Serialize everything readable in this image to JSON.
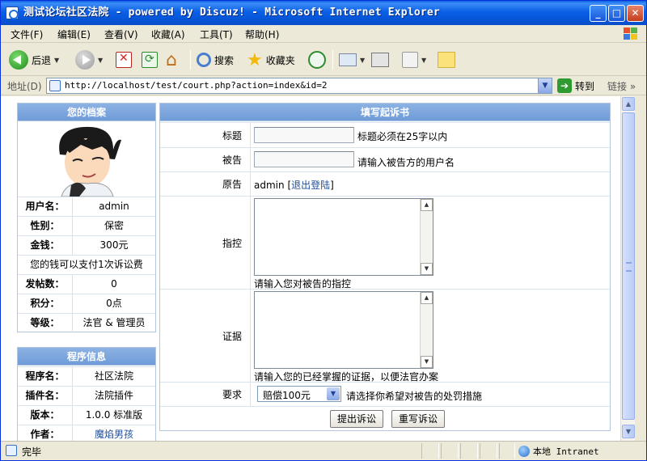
{
  "window": {
    "title": "测试论坛社区法院 - powered by Discuz! - Microsoft Internet Explorer",
    "controls": {
      "minimize": "_",
      "maximize": "□",
      "close": "✕"
    }
  },
  "menu": [
    "文件(F)",
    "编辑(E)",
    "查看(V)",
    "收藏(A)",
    "工具(T)",
    "帮助(H)"
  ],
  "toolbar": {
    "back": "后退",
    "search": "搜索",
    "favorites": "收藏夹"
  },
  "address": {
    "label": "地址(D)",
    "url": "http://localhost/test/court.php?action=index&id=2",
    "go": "转到",
    "links": "链接"
  },
  "profile": {
    "title": "您的档案",
    "rows": [
      {
        "key": "用户名：",
        "value": "admin"
      },
      {
        "key": "性别：",
        "value": "保密"
      },
      {
        "key": "金钱：",
        "value": "300元"
      }
    ],
    "note": "您的钱可以支付1次诉讼费",
    "rows2": [
      {
        "key": "发帖数：",
        "value": "0"
      },
      {
        "key": "积分：",
        "value": "0点"
      },
      {
        "key": "等级：",
        "value": "法官 & 管理员"
      }
    ]
  },
  "program": {
    "title": "程序信息",
    "rows": [
      {
        "key": "程序名：",
        "value": "社区法院"
      },
      {
        "key": "插件名：",
        "value": "法院插件"
      },
      {
        "key": "版本：",
        "value": "1.0.0 标准版"
      },
      {
        "key": "作者：",
        "value": "魔焰男孩"
      }
    ]
  },
  "form": {
    "title": "填写起诉书",
    "subject_label": "标题",
    "subject_hint": "标题必须在25字以内",
    "defendant_label": "被告",
    "defendant_hint": "请输入被告方的用户名",
    "plaintiff_label": "原告",
    "plaintiff_value": "admin",
    "logout_prefix": "[",
    "logout_link": "退出登陆",
    "logout_suffix": "]",
    "accusation_label": "指控",
    "accusation_hint": "请输入您对被告的指控",
    "evidence_label": "证据",
    "evidence_hint": "请输入您的已经掌握的证据，以便法官办案",
    "demand_label": "要求",
    "demand_selected": "赔偿100元",
    "demand_hint": "请选择你希望对被告的处罚措施",
    "submit": "提出诉讼",
    "reset": "重写诉讼"
  },
  "status": {
    "text": "完毕",
    "zone": "本地 Intranet"
  }
}
